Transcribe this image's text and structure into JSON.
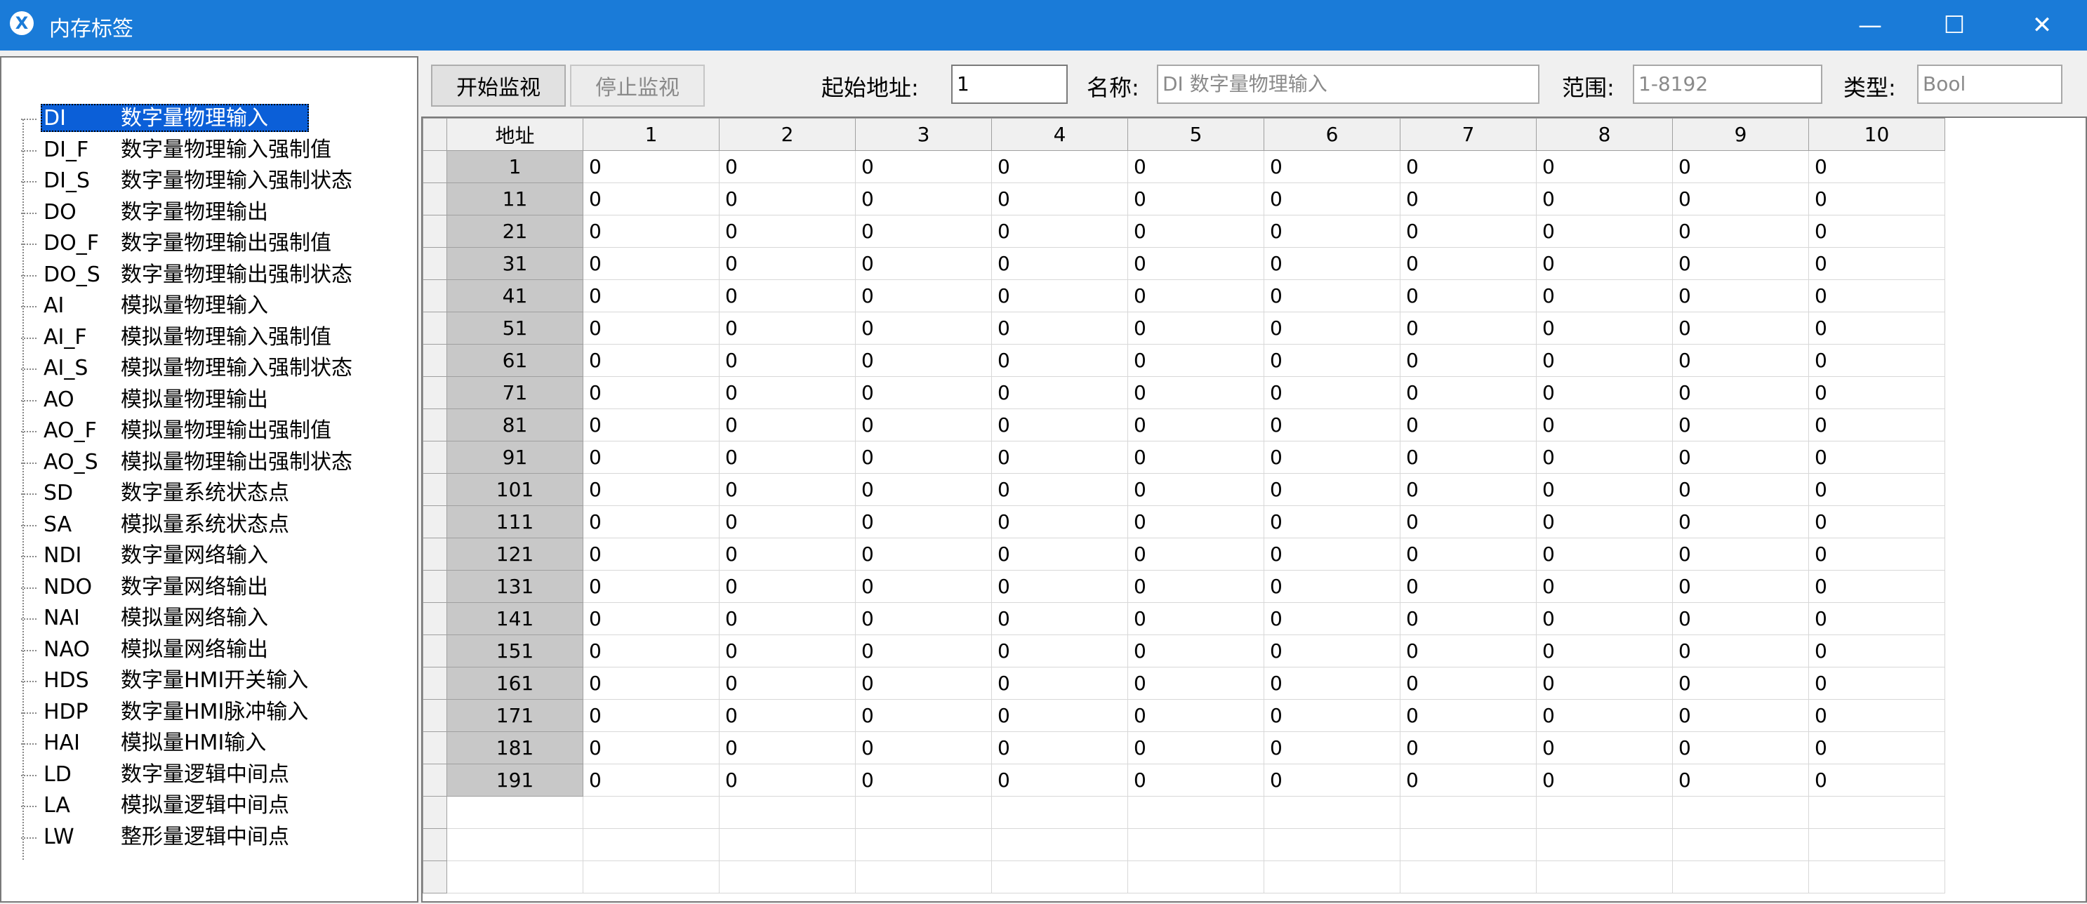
{
  "window": {
    "title": "内存标签",
    "app_icon": "X",
    "min_glyph": "—",
    "max_glyph": "☐",
    "close_glyph": "✕"
  },
  "tree": {
    "items": [
      {
        "code": "DI",
        "desc": "数字量物理输入"
      },
      {
        "code": "DI_F",
        "desc": "数字量物理输入强制值"
      },
      {
        "code": "DI_S",
        "desc": "数字量物理输入强制状态"
      },
      {
        "code": "DO",
        "desc": "数字量物理输出"
      },
      {
        "code": "DO_F",
        "desc": "数字量物理输出强制值"
      },
      {
        "code": "DO_S",
        "desc": "数字量物理输出强制状态"
      },
      {
        "code": "AI",
        "desc": "模拟量物理输入"
      },
      {
        "code": "AI_F",
        "desc": "模拟量物理输入强制值"
      },
      {
        "code": "AI_S",
        "desc": "模拟量物理输入强制状态"
      },
      {
        "code": "AO",
        "desc": "模拟量物理输出"
      },
      {
        "code": "AO_F",
        "desc": "模拟量物理输出强制值"
      },
      {
        "code": "AO_S",
        "desc": "模拟量物理输出强制状态"
      },
      {
        "code": "SD",
        "desc": "数字量系统状态点"
      },
      {
        "code": "SA",
        "desc": "模拟量系统状态点"
      },
      {
        "code": "NDI",
        "desc": "数字量网络输入"
      },
      {
        "code": "NDO",
        "desc": "数字量网络输出"
      },
      {
        "code": "NAI",
        "desc": "模拟量网络输入"
      },
      {
        "code": "NAO",
        "desc": "模拟量网络输出"
      },
      {
        "code": "HDS",
        "desc": "数字量HMI开关输入"
      },
      {
        "code": "HDP",
        "desc": "数字量HMI脉冲输入"
      },
      {
        "code": "HAI",
        "desc": "模拟量HMI输入"
      },
      {
        "code": "LD",
        "desc": "数字量逻辑中间点"
      },
      {
        "code": "LA",
        "desc": "模拟量逻辑中间点"
      },
      {
        "code": "LW",
        "desc": "整形量逻辑中间点"
      }
    ],
    "selected_index": 0
  },
  "toolbar": {
    "start_label": "开始监视",
    "stop_label": "停止监视",
    "start_addr_label": "起始地址:",
    "start_addr_value": "1",
    "name_label": "名称:",
    "name_value": "DI      数字量物理输入",
    "range_label": "范围:",
    "range_value": "1-8192",
    "type_label": "类型:",
    "type_value": "Bool"
  },
  "grid": {
    "headers": [
      "地址",
      "1",
      "2",
      "3",
      "4",
      "5",
      "6",
      "7",
      "8",
      "9",
      "10"
    ],
    "rows": [
      {
        "addr": "1",
        "values": [
          "0",
          "0",
          "0",
          "0",
          "0",
          "0",
          "0",
          "0",
          "0",
          "0"
        ]
      },
      {
        "addr": "11",
        "values": [
          "0",
          "0",
          "0",
          "0",
          "0",
          "0",
          "0",
          "0",
          "0",
          "0"
        ]
      },
      {
        "addr": "21",
        "values": [
          "0",
          "0",
          "0",
          "0",
          "0",
          "0",
          "0",
          "0",
          "0",
          "0"
        ]
      },
      {
        "addr": "31",
        "values": [
          "0",
          "0",
          "0",
          "0",
          "0",
          "0",
          "0",
          "0",
          "0",
          "0"
        ]
      },
      {
        "addr": "41",
        "values": [
          "0",
          "0",
          "0",
          "0",
          "0",
          "0",
          "0",
          "0",
          "0",
          "0"
        ]
      },
      {
        "addr": "51",
        "values": [
          "0",
          "0",
          "0",
          "0",
          "0",
          "0",
          "0",
          "0",
          "0",
          "0"
        ]
      },
      {
        "addr": "61",
        "values": [
          "0",
          "0",
          "0",
          "0",
          "0",
          "0",
          "0",
          "0",
          "0",
          "0"
        ]
      },
      {
        "addr": "71",
        "values": [
          "0",
          "0",
          "0",
          "0",
          "0",
          "0",
          "0",
          "0",
          "0",
          "0"
        ]
      },
      {
        "addr": "81",
        "values": [
          "0",
          "0",
          "0",
          "0",
          "0",
          "0",
          "0",
          "0",
          "0",
          "0"
        ]
      },
      {
        "addr": "91",
        "values": [
          "0",
          "0",
          "0",
          "0",
          "0",
          "0",
          "0",
          "0",
          "0",
          "0"
        ]
      },
      {
        "addr": "101",
        "values": [
          "0",
          "0",
          "0",
          "0",
          "0",
          "0",
          "0",
          "0",
          "0",
          "0"
        ]
      },
      {
        "addr": "111",
        "values": [
          "0",
          "0",
          "0",
          "0",
          "0",
          "0",
          "0",
          "0",
          "0",
          "0"
        ]
      },
      {
        "addr": "121",
        "values": [
          "0",
          "0",
          "0",
          "0",
          "0",
          "0",
          "0",
          "0",
          "0",
          "0"
        ]
      },
      {
        "addr": "131",
        "values": [
          "0",
          "0",
          "0",
          "0",
          "0",
          "0",
          "0",
          "0",
          "0",
          "0"
        ]
      },
      {
        "addr": "141",
        "values": [
          "0",
          "0",
          "0",
          "0",
          "0",
          "0",
          "0",
          "0",
          "0",
          "0"
        ]
      },
      {
        "addr": "151",
        "values": [
          "0",
          "0",
          "0",
          "0",
          "0",
          "0",
          "0",
          "0",
          "0",
          "0"
        ]
      },
      {
        "addr": "161",
        "values": [
          "0",
          "0",
          "0",
          "0",
          "0",
          "0",
          "0",
          "0",
          "0",
          "0"
        ]
      },
      {
        "addr": "171",
        "values": [
          "0",
          "0",
          "0",
          "0",
          "0",
          "0",
          "0",
          "0",
          "0",
          "0"
        ]
      },
      {
        "addr": "181",
        "values": [
          "0",
          "0",
          "0",
          "0",
          "0",
          "0",
          "0",
          "0",
          "0",
          "0"
        ]
      },
      {
        "addr": "191",
        "values": [
          "0",
          "0",
          "0",
          "0",
          "0",
          "0",
          "0",
          "0",
          "0",
          "0"
        ]
      }
    ],
    "empty_rows": 3
  }
}
